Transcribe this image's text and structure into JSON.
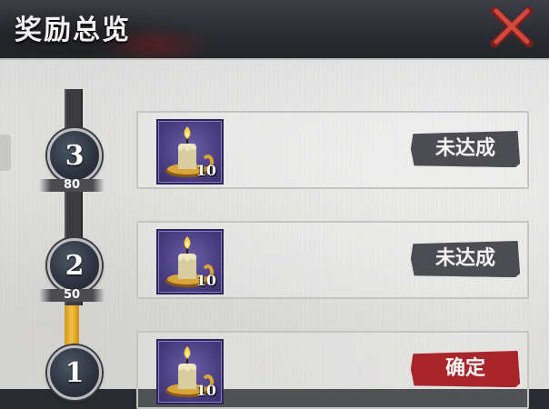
{
  "header": {
    "title": "奖励总览"
  },
  "tiers": [
    {
      "level": "3",
      "threshold": "80",
      "reward_qty": "10",
      "status": "未达成",
      "reached": false
    },
    {
      "level": "2",
      "threshold": "50",
      "reward_qty": "10",
      "status": "未达成",
      "reached": false
    },
    {
      "level": "1",
      "reward_qty": "10",
      "status": "确定",
      "reached": true
    }
  ],
  "colors": {
    "accent_red": "#a8262a",
    "locked_gray": "#4b4d52",
    "progress_gold": "#f2c046",
    "reward_purple": "#463a7c"
  },
  "icons": {
    "close": "close-x-icon",
    "reward": "candle-icon"
  }
}
